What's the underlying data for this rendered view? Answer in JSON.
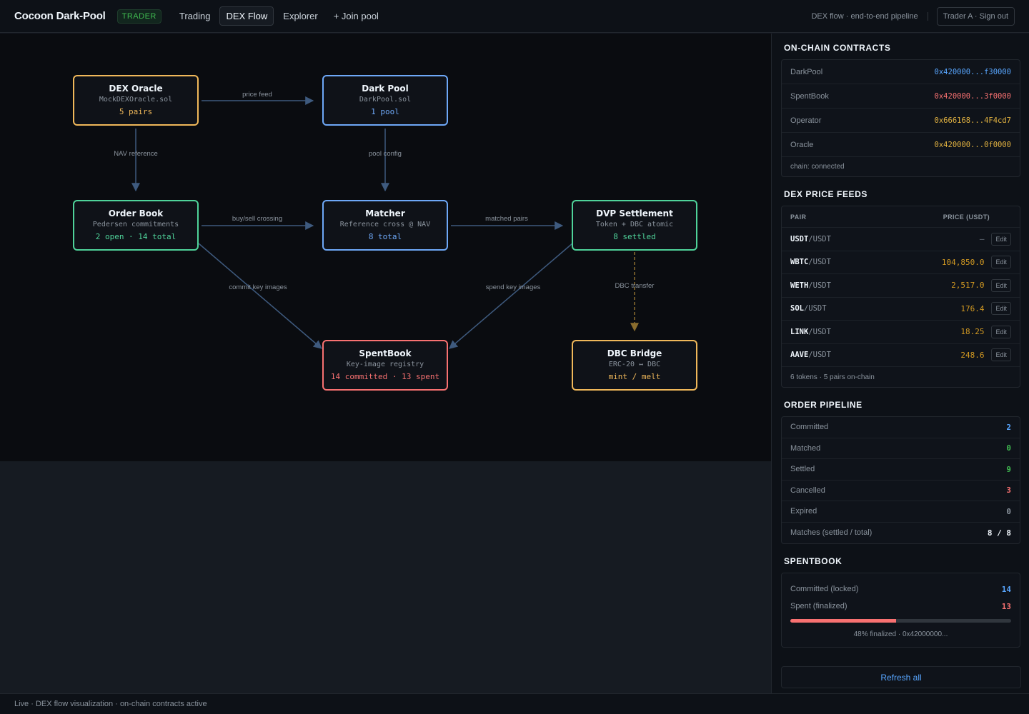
{
  "header": {
    "brand": "Cocoon Dark-Pool",
    "role": "TRADER",
    "nav": [
      {
        "label": "Trading"
      },
      {
        "label": "DEX Flow"
      },
      {
        "label": "Explorer"
      },
      {
        "label": "+ Join pool"
      }
    ],
    "pipeline_label": "DEX flow · end-to-end pipeline",
    "user_label": "Trader A · Sign out"
  },
  "colors": {
    "orange": "#f0b85a",
    "blue": "#6ea8f7",
    "green": "#4fd39a",
    "red": "#f87171",
    "edge": "#3e5a7e"
  },
  "flow": {
    "nodes": {
      "dex_oracle": {
        "title": "DEX Oracle",
        "subtitle": "MockDEXOracle.sol",
        "stat": "5 pairs"
      },
      "dark_pool": {
        "title": "Dark Pool",
        "subtitle": "DarkPool.sol",
        "stat": "1 pool"
      },
      "order_book": {
        "title": "Order Book",
        "subtitle": "Pedersen commitments",
        "stat": "2 open · 14 total"
      },
      "matcher": {
        "title": "Matcher",
        "subtitle": "Reference cross @ NAV",
        "stat": "8 total"
      },
      "dvp_settlement": {
        "title": "DVP Settlement",
        "subtitle": "Token + DBC atomic",
        "stat": "8 settled"
      },
      "spentbook": {
        "title": "SpentBook",
        "subtitle": "Key-image registry",
        "stat": "14 committed · 13 spent"
      },
      "dbc_bridge": {
        "title": "DBC Bridge",
        "subtitle": "ERC-20 ↔ DBC",
        "stat": "mint / melt"
      }
    },
    "edges": {
      "price_feed": "price feed",
      "nav_reference": "NAV reference",
      "pool_config": "pool config",
      "buy_sell_crossing": "buy/sell crossing",
      "matched_pairs": "matched pairs",
      "commit_key_images": "commit key images",
      "spend_key_images": "spend key images",
      "dbc_transfer": "DBC transfer"
    }
  },
  "sidebar": {
    "contracts": {
      "title": "ON-CHAIN CONTRACTS",
      "items": [
        {
          "label": "DarkPool",
          "address": "0x420000...f30000",
          "color": "#58a6ff"
        },
        {
          "label": "SpentBook",
          "address": "0x420000...3f0000",
          "color": "#f87171"
        },
        {
          "label": "Operator",
          "address": "0x666168...4F4cd7",
          "color": "#e3b341"
        },
        {
          "label": "Oracle",
          "address": "0x420000...0f0000",
          "color": "#e3b341"
        }
      ],
      "status": "chain: connected"
    },
    "price_feeds": {
      "title": "DEX PRICE FEEDS",
      "col_pair": "PAIR",
      "col_price": "PRICE (USDT)",
      "quote": "/USDT",
      "edit_label": "Edit",
      "rows": [
        {
          "base": "USDT",
          "price": "—"
        },
        {
          "base": "WBTC",
          "price": "104,850.0"
        },
        {
          "base": "WETH",
          "price": "2,517.0"
        },
        {
          "base": "SOL",
          "price": "176.4"
        },
        {
          "base": "LINK",
          "price": "18.25"
        },
        {
          "base": "AAVE",
          "price": "248.6"
        }
      ],
      "footer": "6 tokens · 5 pairs on-chain"
    },
    "order_pipeline": {
      "title": "ORDER PIPELINE",
      "rows": [
        {
          "label": "Committed",
          "value": "2",
          "color": "#58a6ff"
        },
        {
          "label": "Matched",
          "value": "0",
          "color": "#3fb950"
        },
        {
          "label": "Settled",
          "value": "9",
          "color": "#3fb950"
        },
        {
          "label": "Cancelled",
          "value": "3",
          "color": "#f87171"
        },
        {
          "label": "Expired",
          "value": "0",
          "color": "#8b949e"
        },
        {
          "label": "Matches (settled / total)",
          "value": "8 / 8",
          "color": "#f0f6fc"
        }
      ]
    },
    "spentbook": {
      "title": "SPENTBOOK",
      "committed_label": "Committed (locked)",
      "committed_value": "14",
      "spent_label": "Spent (finalized)",
      "spent_value": "13",
      "finalized_fraction": 0.48,
      "caption": "48% finalized · 0x42000000..."
    },
    "refresh_label": "Refresh all"
  },
  "status_bar": "Live · DEX flow visualization · on-chain contracts active"
}
